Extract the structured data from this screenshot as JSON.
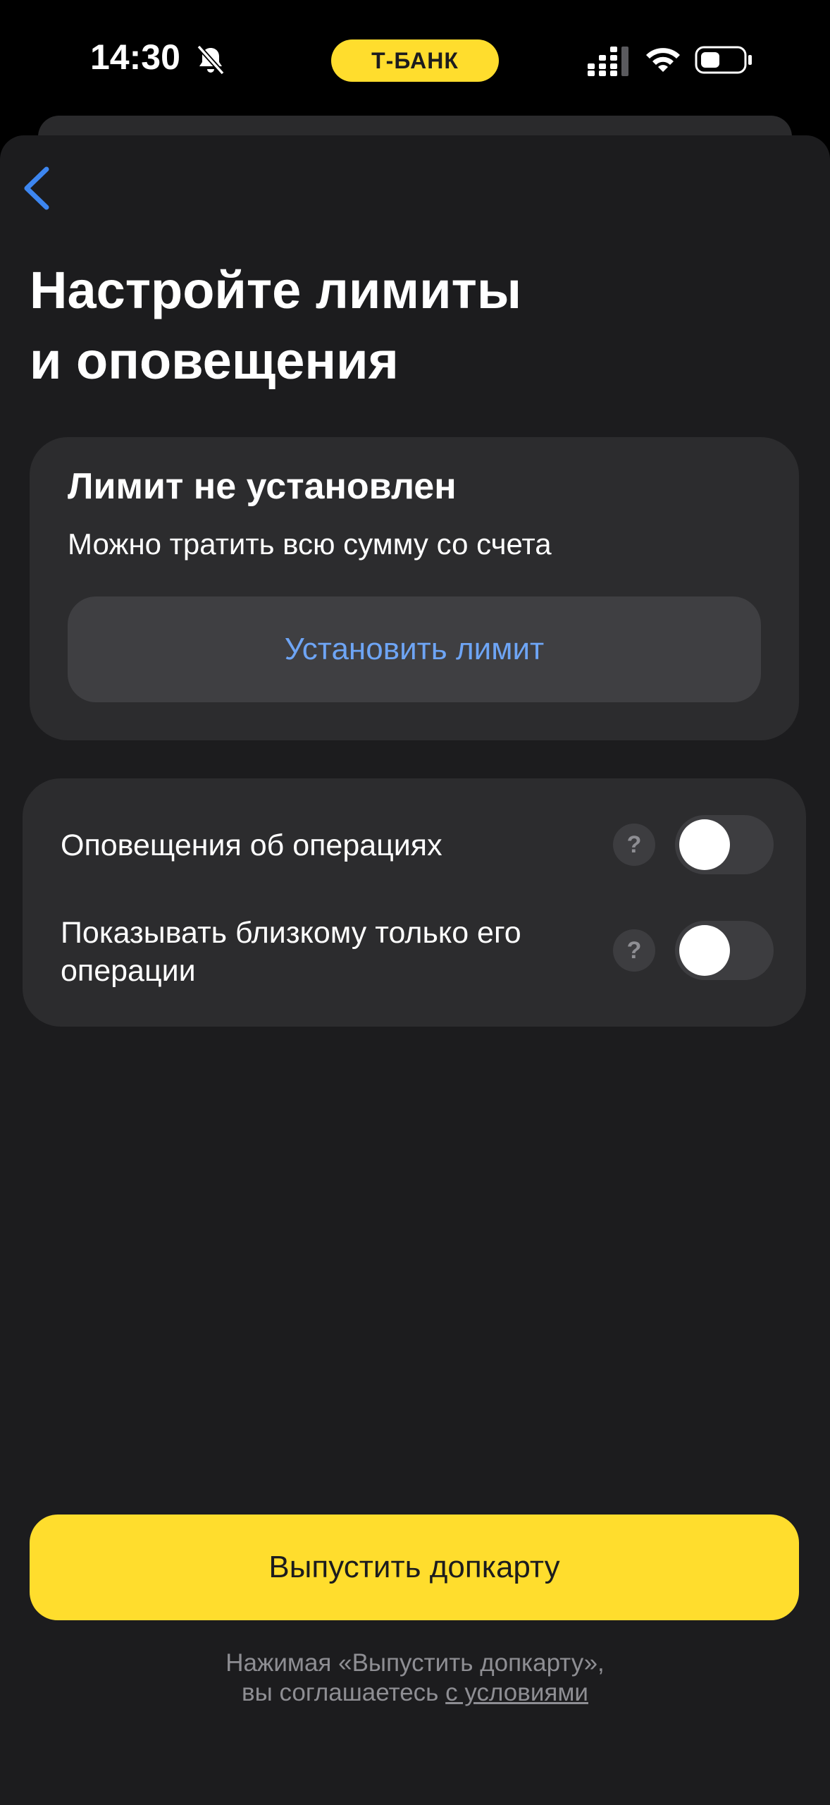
{
  "status_bar": {
    "time": "14:30",
    "brand": "Т-БАНК",
    "icons": [
      "bell-slash-icon",
      "cellular-signal-icon",
      "wifi-icon",
      "battery-icon"
    ]
  },
  "header": {
    "back_icon": "chevron-left-icon",
    "title_line1": "Настройте лимиты",
    "title_line2": "и оповещения"
  },
  "limit_card": {
    "title": "Лимит не установлен",
    "subtitle": "Можно тратить всю сумму со счета",
    "button_label": "Установить лимит"
  },
  "settings": {
    "items": [
      {
        "label": "Оповещения об операциях",
        "help": "?",
        "enabled": false
      },
      {
        "label": "Показывать близкому только его операции",
        "help": "?",
        "enabled": false
      }
    ]
  },
  "footer": {
    "cta_label": "Выпустить допкарту",
    "terms_line1": "Нажимая «Выпустить допкарту»,",
    "terms_line2_prefix": "вы соглашаетесь ",
    "terms_link": "с условиями"
  },
  "colors": {
    "background": "#000000",
    "sheet": "#1c1c1e",
    "card": "#2c2c2e",
    "accent_yellow": "#ffdd2d",
    "link_blue": "#6ea5f5",
    "back_blue": "#3d86f0",
    "muted_text": "#8e8e93"
  }
}
